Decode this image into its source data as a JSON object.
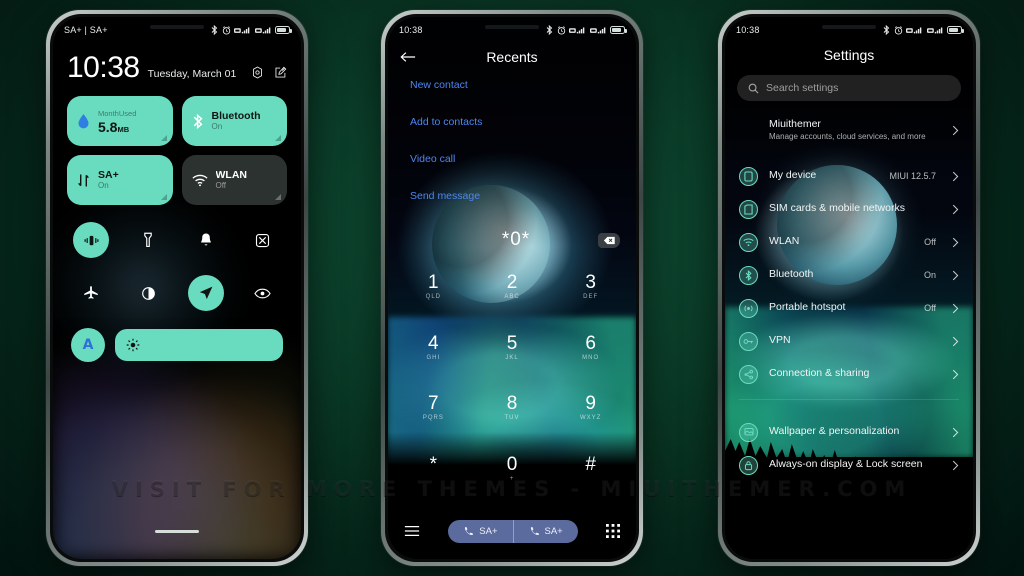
{
  "background": {
    "accent": "#69dcc0",
    "page_bg": "#0a3a27"
  },
  "watermark": {
    "text": "VISIT  FOR  MORE  THEMES  -  MIUITHEMER.COM"
  },
  "phone1": {
    "statusbar": {
      "carrier": "SA+ | SA+",
      "icons": [
        "bluetooth-icon",
        "alarm-icon",
        "sim1-signal-icon",
        "sim2-signal-icon",
        "battery-icon"
      ]
    },
    "clock": {
      "time": "10:38",
      "date": "Tuesday, March 01"
    },
    "header_actions": [
      {
        "name": "settings-gear-icon",
        "label": "Settings"
      },
      {
        "name": "edit-icon",
        "label": "Edit"
      }
    ],
    "tiles": [
      {
        "name": "data-usage-tile",
        "head_left": "Month",
        "head_right": "Used",
        "value": "5.8",
        "unit": "MB",
        "state": "on",
        "icon": "water-drop-icon"
      },
      {
        "name": "bluetooth-tile",
        "title": "Bluetooth",
        "sub": "On",
        "state": "on",
        "icon": "bluetooth-icon"
      },
      {
        "name": "mobile-data-tile",
        "title": "SA+",
        "sub": "On",
        "state": "on",
        "icon": "data-arrows-icon"
      },
      {
        "name": "wlan-tile",
        "title": "WLAN",
        "sub": "Off",
        "state": "off",
        "icon": "wifi-icon"
      }
    ],
    "toggles_row1": [
      {
        "name": "vibrate-toggle",
        "label": "Vibrate",
        "icon": "vibrate-icon",
        "active": true
      },
      {
        "name": "flashlight-toggle",
        "label": "Flashlight",
        "icon": "flashlight-icon",
        "active": false
      },
      {
        "name": "ringer-toggle",
        "label": "Ring",
        "icon": "bell-icon",
        "active": false
      },
      {
        "name": "screenshot-toggle",
        "label": "Screenshot",
        "icon": "screenshot-icon",
        "active": false
      }
    ],
    "toggles_row2": [
      {
        "name": "airplane-toggle",
        "label": "Airplane mode",
        "icon": "airplane-icon",
        "active": false
      },
      {
        "name": "dark-mode-toggle",
        "label": "Dark mode",
        "icon": "contrast-icon",
        "active": false
      },
      {
        "name": "location-toggle",
        "label": "Location",
        "icon": "location-arrow-icon",
        "active": true
      },
      {
        "name": "reading-mode-toggle",
        "label": "Reading mode",
        "icon": "eye-icon",
        "active": false
      }
    ],
    "brightness": {
      "auto_label": "A",
      "slider_icon": "brightness-sun-icon"
    }
  },
  "phone2": {
    "statusbar": {
      "time": "10:38",
      "icons": [
        "bluetooth-icon",
        "alarm-icon",
        "sim1-signal-icon",
        "sim2-signal-icon",
        "battery-icon"
      ]
    },
    "appbar": {
      "back_icon": "back-arrow-icon",
      "title": "Recents"
    },
    "links": [
      {
        "name": "new-contact-link",
        "label": "New contact"
      },
      {
        "name": "add-to-contacts-link",
        "label": "Add to contacts"
      },
      {
        "name": "video-call-link",
        "label": "Video call"
      },
      {
        "name": "send-message-link",
        "label": "Send message"
      }
    ],
    "dial_input": {
      "value": "*0*",
      "delete_icon": "backspace-icon"
    },
    "keypad": [
      {
        "num": "1",
        "letters": "QLD"
      },
      {
        "num": "2",
        "letters": "ABC"
      },
      {
        "num": "3",
        "letters": "DEF"
      },
      {
        "num": "4",
        "letters": "GHI"
      },
      {
        "num": "5",
        "letters": "JKL"
      },
      {
        "num": "6",
        "letters": "MNO"
      },
      {
        "num": "7",
        "letters": "PQRS"
      },
      {
        "num": "8",
        "letters": "TUV"
      },
      {
        "num": "9",
        "letters": "WXYZ"
      },
      {
        "num": "*",
        "letters": ""
      },
      {
        "num": "0",
        "letters": "+"
      },
      {
        "num": "#",
        "letters": ""
      }
    ],
    "bottombar": {
      "menu_icon": "menu-icon",
      "call_buttons": [
        {
          "name": "call-sim1-button",
          "label": "SA+",
          "icon": "phone-icon"
        },
        {
          "name": "call-sim2-button",
          "label": "SA+",
          "icon": "phone-icon"
        }
      ],
      "keypad_icon": "dialpad-icon"
    }
  },
  "phone3": {
    "statusbar": {
      "time": "10:38",
      "icons": [
        "bluetooth-icon",
        "alarm-icon",
        "sim1-signal-icon",
        "sim2-signal-icon",
        "battery-icon"
      ]
    },
    "title": "Settings",
    "search": {
      "placeholder": "Search settings",
      "icon": "search-icon"
    },
    "account": {
      "name": "Miuithemer",
      "sub": "Manage accounts, cloud services, and more"
    },
    "items": [
      {
        "name": "my-device",
        "label": "My device",
        "value": "MIUI 12.5.7",
        "icon": "phone-device-icon"
      },
      {
        "name": "sim-cards-mobile-networks",
        "label": "SIM cards & mobile networks",
        "value": "",
        "icon": "sim-card-icon"
      },
      {
        "name": "wlan",
        "label": "WLAN",
        "value": "Off",
        "icon": "wifi-icon"
      },
      {
        "name": "bluetooth",
        "label": "Bluetooth",
        "value": "On",
        "icon": "bluetooth-icon"
      },
      {
        "name": "portable-hotspot",
        "label": "Portable hotspot",
        "value": "Off",
        "icon": "hotspot-icon"
      },
      {
        "name": "vpn",
        "label": "VPN",
        "value": "",
        "icon": "vpn-key-icon"
      },
      {
        "name": "connection-sharing",
        "label": "Connection & sharing",
        "value": "",
        "icon": "share-icon"
      }
    ],
    "items2": [
      {
        "name": "wallpaper-personalization",
        "label": "Wallpaper & personalization",
        "value": "",
        "icon": "wallpaper-icon"
      },
      {
        "name": "always-on-display-lock-screen",
        "label": "Always-on display & Lock screen",
        "value": "",
        "icon": "lock-icon"
      }
    ]
  }
}
